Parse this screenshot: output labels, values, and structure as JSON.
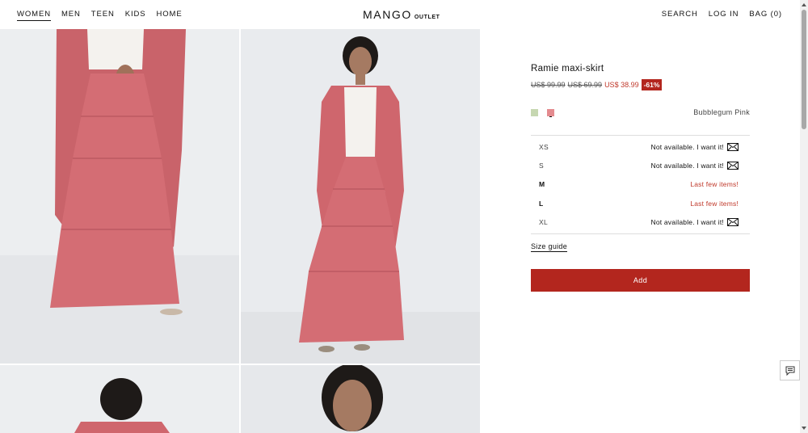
{
  "header": {
    "nav": [
      "WOMEN",
      "MEN",
      "TEEN",
      "KIDS",
      "HOME"
    ],
    "logo": {
      "brand": "MANGO",
      "sub": "OUTLET"
    },
    "search": "SEARCH",
    "login": "LOG IN",
    "bag": "BAG (0)"
  },
  "product": {
    "title": "Ramie maxi-skirt",
    "prices": {
      "original": "US$ 99.99",
      "previous": "US$ 69.99",
      "current": "US$ 38.99",
      "discount": "-61%"
    },
    "colors": [
      {
        "name": "sage",
        "hex": "#c6d7b1"
      },
      {
        "name": "Bubblegum Pink",
        "hex": "#e48b8f"
      }
    ],
    "color_name": "Bubblegum Pink",
    "sizes": [
      {
        "label": "XS",
        "status": "Not available. I want it!"
      },
      {
        "label": "S",
        "status": "Not available. I want it!"
      },
      {
        "label": "M",
        "status": "Last few items!"
      },
      {
        "label": "L",
        "status": "Last few items!"
      },
      {
        "label": "XL",
        "status": "Not available. I want it!"
      }
    ],
    "size_guide": "Size guide",
    "add_label": "Add"
  },
  "theme": {
    "accent": "#b3261e",
    "skirt": "#d06a70"
  }
}
